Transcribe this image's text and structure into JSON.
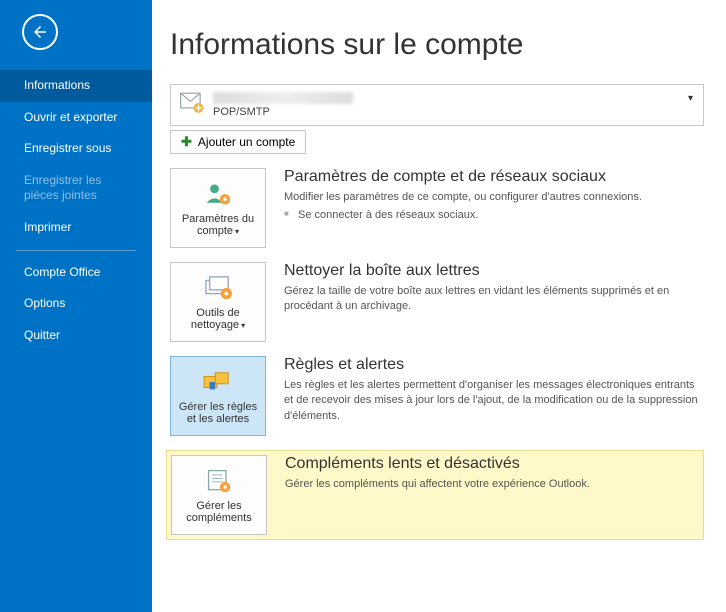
{
  "sidebar": {
    "items": [
      {
        "label": "Informations",
        "active": true,
        "disabled": false
      },
      {
        "label": "Ouvrir et exporter",
        "active": false,
        "disabled": false
      },
      {
        "label": "Enregistrer sous",
        "active": false,
        "disabled": false
      },
      {
        "label": "Enregistrer les pièces jointes",
        "active": false,
        "disabled": true
      },
      {
        "label": "Imprimer",
        "active": false,
        "disabled": false
      },
      {
        "label": "Compte Office",
        "active": false,
        "disabled": false
      },
      {
        "label": "Options",
        "active": false,
        "disabled": false
      },
      {
        "label": "Quitter",
        "active": false,
        "disabled": false
      }
    ]
  },
  "page": {
    "title": "Informations sur le compte"
  },
  "account": {
    "protocol": "POP/SMTP",
    "add_label": "Ajouter un compte"
  },
  "sections": {
    "params": {
      "tile_label": "Paramètres du compte",
      "heading": "Paramètres de compte et de réseaux sociaux",
      "desc": "Modifier les paramètres de ce compte, ou configurer d'autres connexions.",
      "bullet": "Se connecter à des réseaux sociaux."
    },
    "cleanup": {
      "tile_label": "Outils de nettoyage",
      "heading": "Nettoyer la boîte aux lettres",
      "desc": "Gérez la taille de votre boîte aux lettres en vidant les éléments supprimés et en procédant à un archivage."
    },
    "rules": {
      "tile_label": "Gérer les règles et les alertes",
      "heading": "Règles et alertes",
      "desc": "Les règles et les alertes permettent d'organiser les messages électroniques entrants et de recevoir des mises à jour lors de l'ajout, de la modification ou de la suppression d'éléments."
    },
    "addins": {
      "tile_label": "Gérer les compléments",
      "heading": "Compléments lents et désactivés",
      "desc": "Gérer les compléments qui affectent votre expérience Outlook."
    }
  }
}
